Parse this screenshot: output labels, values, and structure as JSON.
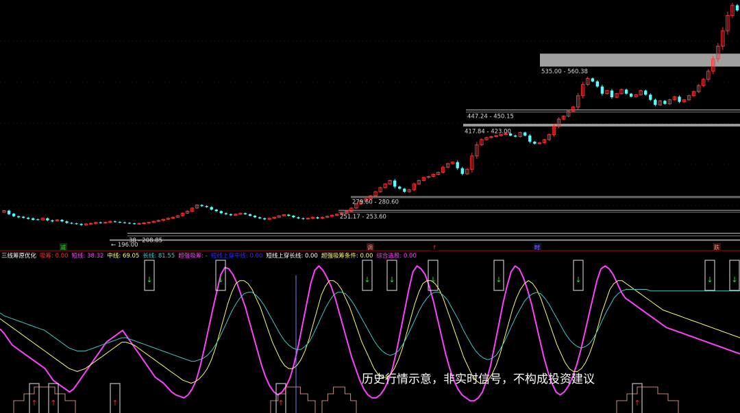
{
  "colors": {
    "up": "#ff3232",
    "down": "#54ffff",
    "short": "#ff40ff",
    "mid": "#ffff66",
    "long": "#40c8c8",
    "panel_divider": "#b4001e",
    "level_band": "#a0a0a0",
    "buy": "#ff2020",
    "sell": "#20e020"
  },
  "price_levels": [
    {
      "label": "535.00 - 560.38",
      "low": 535,
      "high": 560.38
    },
    {
      "label": "447.24 - 450.15",
      "low": 447.24,
      "high": 450.15
    },
    {
      "label": "417.84 - 423.00",
      "low": 417.84,
      "high": 423
    },
    {
      "label": "279.60 - 280.60",
      "low": 279.6,
      "high": 280.6
    },
    {
      "label": "251.17 - 253.60",
      "low": 251.17,
      "high": 253.6
    },
    {
      "label": "38 - 208.85",
      "low": 205,
      "high": 208.85
    },
    {
      "label": "← 196.00",
      "low": 196,
      "high": 196
    }
  ],
  "indicator_header": [
    {
      "text": "三线筹原优化",
      "color": "#ffffff"
    },
    {
      "text": "吸筹: 0.00",
      "color": "#ff3030"
    },
    {
      "text": "短线: 38.32",
      "color": "#ff40ff"
    },
    {
      "text": "中线: 69.05",
      "color": "#ffff66"
    },
    {
      "text": "长线: 81.55",
      "color": "#40c8c8"
    },
    {
      "text": "超强吸筹: -",
      "color": "#ff40ff"
    },
    {
      "text": "短线上穿中线: 0.00",
      "color": "#3030ff"
    },
    {
      "text": "短线上穿长线: 0.00",
      "color": "#ffffff"
    },
    {
      "text": "超强吸筹条件: 0.00",
      "color": "#ffff66"
    },
    {
      "text": "综合选股: 0.00",
      "color": "#ff40ff"
    }
  ],
  "period_tags": [
    {
      "text": "减",
      "color": "#20e020",
      "bg": "#103010"
    },
    {
      "text": "调",
      "color": "#ff9070",
      "bg": "#401010"
    },
    {
      "text": "f",
      "color": "#ff3030",
      "bg": "#000000"
    },
    {
      "text": "时",
      "color": "#8080ff",
      "bg": "#101040"
    },
    {
      "text": "跌",
      "color": "#ff9070",
      "bg": "#401010"
    }
  ],
  "disclaimer": "历史行情示意，非实时信号，不构成投资建议",
  "chart_data": {
    "type": "candlestick",
    "price_range": [
      180,
      660
    ],
    "candles": [
      [
        250,
        253
      ],
      [
        253,
        246
      ],
      [
        247,
        242
      ],
      [
        242,
        240
      ],
      [
        241,
        239
      ],
      [
        239,
        237
      ],
      [
        238,
        235
      ],
      [
        236,
        235
      ],
      [
        235,
        238
      ],
      [
        238,
        234
      ],
      [
        234,
        232
      ],
      [
        233,
        235
      ],
      [
        235,
        232
      ],
      [
        232,
        229
      ],
      [
        229,
        228
      ],
      [
        228,
        227
      ],
      [
        227,
        225
      ],
      [
        225,
        227
      ],
      [
        227,
        228
      ],
      [
        228,
        230
      ],
      [
        230,
        229
      ],
      [
        229,
        230
      ],
      [
        230,
        232
      ],
      [
        232,
        231
      ],
      [
        231,
        230
      ],
      [
        230,
        229
      ],
      [
        229,
        228
      ],
      [
        228,
        227
      ],
      [
        227,
        228
      ],
      [
        228,
        229
      ],
      [
        229,
        230
      ],
      [
        230,
        232
      ],
      [
        232,
        234
      ],
      [
        234,
        236
      ],
      [
        236,
        238
      ],
      [
        238,
        240
      ],
      [
        240,
        243
      ],
      [
        243,
        248
      ],
      [
        248,
        252
      ],
      [
        252,
        258
      ],
      [
        258,
        264
      ],
      [
        264,
        262
      ],
      [
        262,
        260
      ],
      [
        260,
        255
      ],
      [
        255,
        252
      ],
      [
        252,
        248
      ],
      [
        248,
        246
      ],
      [
        246,
        244
      ],
      [
        244,
        246
      ],
      [
        246,
        248
      ],
      [
        248,
        246
      ],
      [
        246,
        243
      ],
      [
        243,
        240
      ],
      [
        240,
        238
      ],
      [
        238,
        236
      ],
      [
        236,
        238
      ],
      [
        238,
        240
      ],
      [
        240,
        243
      ],
      [
        243,
        245
      ],
      [
        245,
        243
      ],
      [
        243,
        240
      ],
      [
        240,
        238
      ],
      [
        238,
        237
      ],
      [
        237,
        238
      ],
      [
        238,
        240
      ],
      [
        240,
        238
      ],
      [
        238,
        240
      ],
      [
        240,
        242
      ],
      [
        242,
        244
      ],
      [
        244,
        246
      ],
      [
        246,
        248
      ],
      [
        248,
        252
      ],
      [
        252,
        258
      ],
      [
        258,
        266
      ],
      [
        266,
        272
      ],
      [
        272,
        276
      ],
      [
        276,
        282
      ],
      [
        282,
        290
      ],
      [
        290,
        298
      ],
      [
        298,
        305
      ],
      [
        305,
        312
      ],
      [
        312,
        300
      ],
      [
        300,
        296
      ],
      [
        296,
        290
      ],
      [
        290,
        294
      ],
      [
        294,
        305
      ],
      [
        305,
        312
      ],
      [
        312,
        318
      ],
      [
        318,
        320
      ],
      [
        320,
        324
      ],
      [
        324,
        328
      ],
      [
        328,
        338
      ],
      [
        338,
        345
      ],
      [
        345,
        348
      ],
      [
        348,
        336
      ],
      [
        336,
        325
      ],
      [
        325,
        334
      ],
      [
        334,
        360
      ],
      [
        360,
        382
      ],
      [
        382,
        392
      ],
      [
        392,
        396
      ],
      [
        396,
        398
      ],
      [
        398,
        400
      ],
      [
        400,
        402
      ],
      [
        402,
        404
      ],
      [
        404,
        400
      ],
      [
        400,
        398
      ],
      [
        398,
        406
      ],
      [
        406,
        400
      ],
      [
        400,
        388
      ],
      [
        388,
        384
      ],
      [
        384,
        386
      ],
      [
        386,
        392
      ],
      [
        392,
        402
      ],
      [
        402,
        418
      ],
      [
        418,
        432
      ],
      [
        432,
        438
      ],
      [
        438,
        448
      ],
      [
        448,
        456
      ],
      [
        456,
        478
      ],
      [
        478,
        500
      ],
      [
        500,
        512
      ],
      [
        512,
        506
      ],
      [
        506,
        496
      ],
      [
        496,
        482
      ],
      [
        482,
        488
      ],
      [
        488,
        475
      ],
      [
        475,
        482
      ],
      [
        482,
        490
      ],
      [
        490,
        482
      ],
      [
        482,
        476
      ],
      [
        476,
        480
      ],
      [
        480,
        488
      ],
      [
        488,
        480
      ],
      [
        480,
        470
      ],
      [
        470,
        460
      ],
      [
        460,
        468
      ],
      [
        468,
        462
      ],
      [
        462,
        470
      ],
      [
        470,
        476
      ],
      [
        476,
        466
      ],
      [
        466,
        470
      ],
      [
        470,
        478
      ],
      [
        478,
        486
      ],
      [
        486,
        498
      ],
      [
        498,
        510
      ],
      [
        510,
        526
      ],
      [
        526,
        550
      ],
      [
        550,
        575
      ],
      [
        575,
        605
      ],
      [
        605,
        635
      ],
      [
        635,
        655
      ],
      [
        655,
        645
      ]
    ],
    "oscillator_range": [
      0,
      100
    ],
    "series": [
      {
        "name": "短线",
        "values": [
          55,
          52,
          48,
          44,
          42,
          40,
          38,
          36,
          34,
          32,
          30,
          28,
          24,
          20,
          18,
          16,
          14,
          12,
          14,
          18,
          22,
          26,
          30,
          34,
          38,
          42,
          46,
          48,
          50,
          52,
          54,
          50,
          46,
          42,
          38,
          34,
          30,
          26,
          22,
          20,
          18,
          15,
          12,
          10,
          9,
          8,
          10,
          14,
          20,
          30,
          42,
          55,
          68,
          80,
          92,
          97,
          96,
          92,
          86,
          78,
          70,
          60,
          50,
          40,
          30,
          22,
          16,
          12,
          10,
          12,
          16,
          22,
          32,
          44,
          58,
          72,
          86,
          95,
          98,
          95,
          90,
          84,
          76,
          66,
          56,
          46,
          36,
          28,
          20,
          14,
          10,
          8,
          8,
          10,
          14,
          20,
          28,
          40,
          54,
          68,
          82,
          94,
          98,
          96,
          92,
          84,
          74,
          62,
          50,
          38,
          28,
          20,
          14,
          10,
          8,
          6,
          6,
          8,
          12,
          20,
          30,
          44,
          58,
          72,
          84,
          94,
          98,
          96,
          90,
          82,
          72,
          60,
          48,
          36,
          26,
          18,
          12,
          10,
          12,
          16,
          22,
          30,
          40,
          52,
          64,
          76,
          88,
          96,
          98,
          96,
          92,
          86,
          80,
          76,
          74,
          72,
          70,
          68,
          66,
          64,
          62,
          60,
          58,
          56,
          55,
          54,
          53,
          52,
          51,
          50,
          49,
          48,
          47,
          46,
          45,
          44,
          43,
          42,
          41,
          40,
          39,
          38
        ]
      },
      {
        "name": "中线",
        "values": [
          62,
          60,
          58,
          56,
          54,
          52,
          50,
          48,
          46,
          44,
          42,
          40,
          38,
          36,
          34,
          32,
          30,
          28,
          27,
          26,
          27,
          28,
          30,
          32,
          34,
          36,
          38,
          40,
          42,
          44,
          46,
          46,
          45,
          44,
          42,
          40,
          38,
          36,
          34,
          32,
          30,
          28,
          26,
          24,
          22,
          20,
          19,
          18,
          19,
          21,
          24,
          28,
          34,
          42,
          52,
          62,
          72,
          80,
          86,
          88,
          88,
          86,
          82,
          76,
          70,
          62,
          54,
          46,
          40,
          34,
          30,
          28,
          28,
          30,
          34,
          40,
          48,
          58,
          68,
          78,
          84,
          88,
          88,
          86,
          82,
          76,
          70,
          62,
          54,
          46,
          40,
          34,
          28,
          24,
          22,
          22,
          24,
          28,
          34,
          42,
          52,
          62,
          72,
          80,
          86,
          88,
          88,
          86,
          82,
          76,
          68,
          60,
          52,
          44,
          36,
          30,
          24,
          20,
          18,
          18,
          20,
          24,
          30,
          38,
          48,
          58,
          68,
          76,
          82,
          86,
          88,
          86,
          82,
          76,
          68,
          60,
          52,
          44,
          38,
          32,
          28,
          26,
          26,
          28,
          32,
          38,
          46,
          56,
          66,
          74,
          82,
          86,
          88,
          88,
          86,
          84,
          82,
          80,
          78,
          76,
          74,
          72,
          70,
          68,
          67,
          66,
          65,
          64,
          63,
          62,
          61,
          60,
          59,
          58,
          57,
          56,
          55,
          54,
          53,
          52,
          51,
          50,
          49
        ]
      },
      {
        "name": "长线",
        "values": [
          66,
          64,
          63,
          62,
          61,
          60,
          59,
          58,
          57,
          56,
          55,
          54,
          52,
          50,
          48,
          46,
          44,
          42,
          41,
          40,
          40,
          40,
          41,
          42,
          43,
          44,
          45,
          46,
          47,
          48,
          49,
          49,
          48,
          47,
          46,
          45,
          44,
          43,
          42,
          41,
          40,
          39,
          38,
          37,
          36,
          35,
          34,
          33,
          33,
          34,
          35,
          37,
          40,
          44,
          49,
          55,
          61,
          67,
          72,
          76,
          79,
          80,
          80,
          78,
          75,
          71,
          66,
          61,
          56,
          51,
          47,
          44,
          42,
          41,
          41,
          43,
          46,
          51,
          57,
          63,
          69,
          74,
          78,
          80,
          80,
          79,
          76,
          72,
          67,
          62,
          57,
          52,
          47,
          43,
          40,
          38,
          37,
          38,
          40,
          44,
          49,
          55,
          61,
          67,
          72,
          76,
          79,
          80,
          80,
          78,
          75,
          70,
          65,
          60,
          54,
          49,
          44,
          40,
          37,
          35,
          34,
          35,
          37,
          41,
          46,
          52,
          58,
          64,
          69,
          74,
          77,
          79,
          80,
          79,
          76,
          72,
          67,
          62,
          57,
          52,
          48,
          45,
          43,
          42,
          43,
          45,
          49,
          54,
          60,
          66,
          71,
          76,
          79,
          81,
          82,
          82,
          82,
          82,
          82,
          82,
          81,
          81,
          81,
          81,
          81,
          81,
          81,
          81,
          81,
          81,
          81,
          81,
          81,
          81,
          81,
          81,
          81,
          81,
          81,
          81,
          81,
          81,
          81
        ]
      }
    ]
  }
}
